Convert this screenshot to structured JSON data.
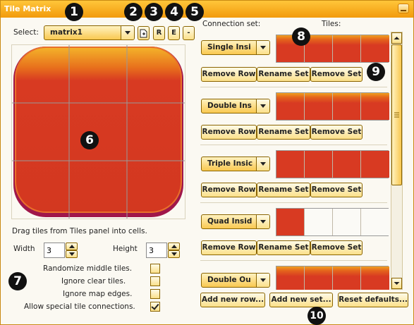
{
  "window": {
    "title": "Tile Matrix"
  },
  "select": {
    "label": "Select:",
    "value": "matrix1"
  },
  "toolbar": {
    "r_label": "R",
    "e_label": "E",
    "minus_label": "-"
  },
  "hint": "Drag tiles from Tiles panel into cells.",
  "width": {
    "label": "Width",
    "value": "3"
  },
  "height": {
    "label": "Height",
    "value": "3"
  },
  "options": [
    {
      "label": "Randomize middle tiles.",
      "checked": false
    },
    {
      "label": "Ignore clear tiles.",
      "checked": false
    },
    {
      "label": "Ignore map edges.",
      "checked": false
    },
    {
      "label": "Allow special tile connections.",
      "checked": true
    }
  ],
  "headers": {
    "connection_set": "Connection set:",
    "tiles": "Tiles:"
  },
  "sets": [
    {
      "name": "Single Insi"
    },
    {
      "name": "Double Ins"
    },
    {
      "name": "Triple Insic"
    },
    {
      "name": "Quad Insid"
    },
    {
      "name": "Double Ou"
    }
  ],
  "set_buttons": {
    "remove_row": "Remove Row",
    "rename_set": "Rename Set",
    "remove_set": "Remove Set"
  },
  "bottom_buttons": {
    "add_row": "Add new row...",
    "add_set": "Add new set...",
    "reset": "Reset defaults..."
  },
  "badges": [
    "1",
    "2",
    "3",
    "4",
    "5",
    "6",
    "7",
    "8",
    "9",
    "10"
  ],
  "colors": {
    "accent": "#f29a0c",
    "tile_red": "#d83a22",
    "tile_orange": "#f0a020"
  }
}
